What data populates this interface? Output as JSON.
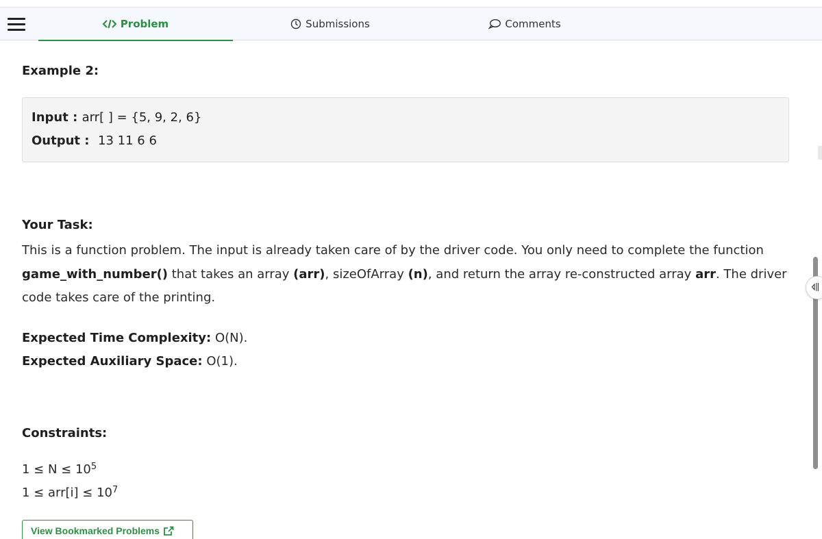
{
  "tabs": [
    {
      "label": "Problem",
      "icon": "code-icon",
      "active": true
    },
    {
      "label": "Submissions",
      "icon": "clock-icon",
      "active": false
    },
    {
      "label": "Comments",
      "icon": "comment-icon",
      "active": false
    }
  ],
  "example": {
    "title": "Example 2:",
    "input_label": "Input",
    "input_value": "arr[ ] = {5, 9, 2, 6}",
    "output_label": "Output",
    "output_value": "13 11 6 6"
  },
  "task": {
    "title": "Your Task:",
    "text_1": "This is a function problem. The input is already taken care of by the driver code. You only need to complete the function ",
    "function_name": "game_with_number()",
    "text_2": " that takes an array ",
    "param_1": "(arr)",
    "text_3": ", sizeOfArray ",
    "param_2": "(n)",
    "text_4": ", and return the array re-constructed array ",
    "return_name": "arr",
    "text_5": ". The driver code takes care of the printing."
  },
  "complexity": {
    "time_label": "Expected Time Complexity:",
    "time_value": "O(N).",
    "space_label": "Expected Auxiliary Space:",
    "space_value": "O(1)."
  },
  "constraints": {
    "title": "Constraints:",
    "line_1": "1 ≤ N ≤ 10",
    "line_1_exp": "5",
    "line_2": "1 ≤ arr[i] ≤ 10",
    "line_2_exp": "7"
  },
  "bookmark_button": {
    "label": "View Bookmarked Problems",
    "icon": "external-link-icon"
  },
  "colors": {
    "accent": "#2f8d46",
    "tabbar_bg": "#f5f8fc",
    "example_bg": "#f4f4f4"
  }
}
